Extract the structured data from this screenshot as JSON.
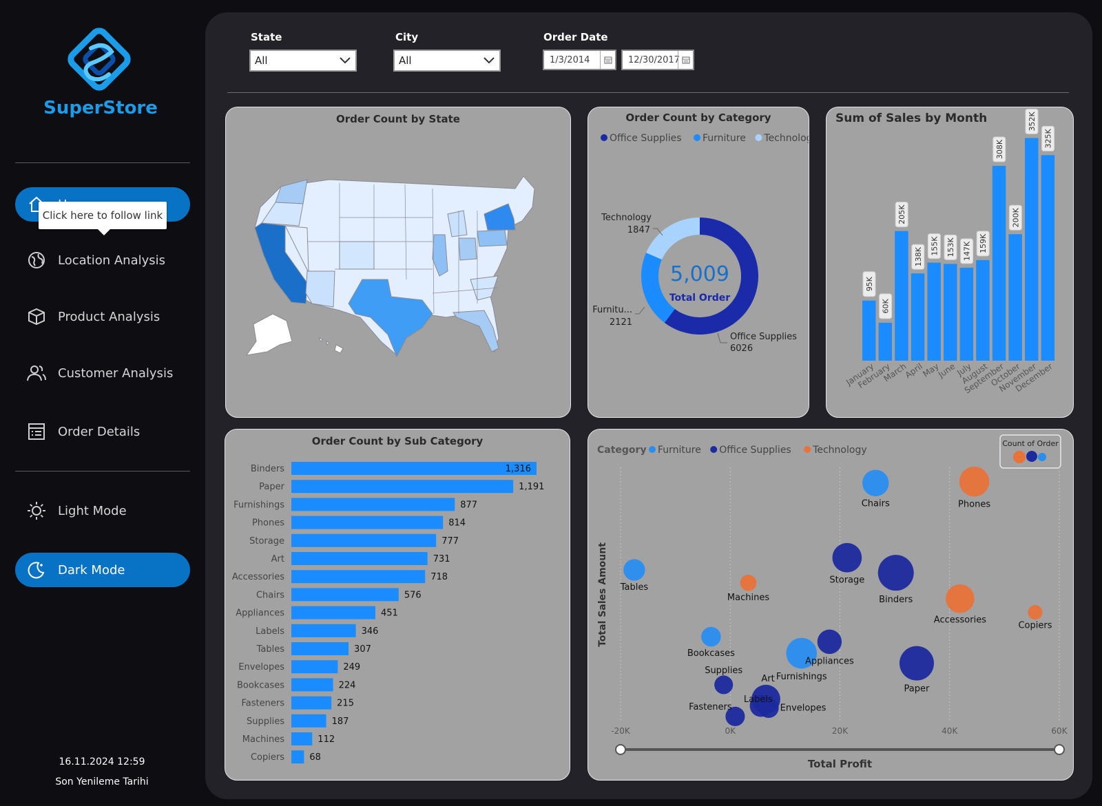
{
  "sidebar": {
    "logo_text": "SuperStore",
    "nav": [
      {
        "label": "Home",
        "icon": "home-icon",
        "active": true
      },
      {
        "label": "Location Analysis",
        "icon": "globe-icon",
        "active": false
      },
      {
        "label": "Product Analysis",
        "icon": "box-icon",
        "active": false
      },
      {
        "label": "Customer Analysis",
        "icon": "users-icon",
        "active": false
      },
      {
        "label": "Order Details",
        "icon": "list-icon",
        "active": false
      }
    ],
    "modes": [
      {
        "label": "Light Mode",
        "icon": "sun-icon",
        "active": false
      },
      {
        "label": "Dark Mode",
        "icon": "moon-icon",
        "active": true
      }
    ],
    "tooltip": "Click here to follow link",
    "refresh_time": "16.11.2024 12:59",
    "refresh_label": "Son Yenileme Tarihi"
  },
  "filters": {
    "state": {
      "label": "State",
      "value": "All"
    },
    "city": {
      "label": "City",
      "value": "All"
    },
    "order_date": {
      "label": "Order Date",
      "start": "1/3/2014",
      "end": "12/30/2017"
    }
  },
  "map_card": {
    "title": "Order Count by State"
  },
  "chart_data": [
    {
      "type": "pie",
      "title": "Order Count by Category",
      "center_value": "5,009",
      "center_label": "Total Order",
      "legend": [
        "Office Supplies",
        "Furniture",
        "Technology"
      ],
      "slices": [
        {
          "label": "Office Supplies",
          "value": 6026,
          "display": "6026",
          "color": "#1a2aa8"
        },
        {
          "label": "Furniture",
          "value": 2121,
          "display": "2121",
          "short": "Furnitu...",
          "color": "#1a8cff"
        },
        {
          "label": "Technology",
          "value": 1847,
          "display": "1847",
          "color": "#a9d3ff"
        }
      ]
    },
    {
      "type": "bar",
      "title": "Sum of Sales by Month",
      "categories": [
        "January",
        "February",
        "March",
        "April",
        "May",
        "June",
        "July",
        "August",
        "September",
        "October",
        "November",
        "December"
      ],
      "values": [
        95000,
        60000,
        205000,
        138000,
        155000,
        153000,
        147000,
        159000,
        308000,
        200000,
        352000,
        325000
      ],
      "labels": [
        "95K",
        "60K",
        "205K",
        "138K",
        "155K",
        "153K",
        "147K",
        "159K",
        "308K",
        "200K",
        "352K",
        "325K"
      ],
      "color": "#1a8cff"
    },
    {
      "type": "bar",
      "orientation": "horizontal",
      "title": "Order Count by Sub Category",
      "categories": [
        "Binders",
        "Paper",
        "Furnishings",
        "Phones",
        "Storage",
        "Art",
        "Accessories",
        "Chairs",
        "Appliances",
        "Labels",
        "Tables",
        "Envelopes",
        "Bookcases",
        "Fasteners",
        "Supplies",
        "Machines",
        "Copiers"
      ],
      "values": [
        1316,
        1191,
        877,
        814,
        777,
        731,
        718,
        576,
        451,
        346,
        307,
        249,
        224,
        215,
        187,
        112,
        68
      ],
      "labels": [
        "1,316",
        "1,191",
        "877",
        "814",
        "777",
        "731",
        "718",
        "576",
        "451",
        "346",
        "307",
        "249",
        "224",
        "215",
        "187",
        "112",
        "68"
      ],
      "color": "#1a8cff"
    },
    {
      "type": "scatter",
      "xlabel": "Total Profit",
      "ylabel": "Total Sales Amount",
      "x_ticks": [
        "-20K",
        "0K",
        "20K",
        "40K",
        "60K"
      ],
      "xlim": [
        -20000,
        60000
      ],
      "legend_title": "Category",
      "size_legend_title": "Count of Order",
      "series": [
        {
          "name": "Furniture",
          "color": "#2a8ef0"
        },
        {
          "name": "Office Supplies",
          "color": "#1d2a9e"
        },
        {
          "name": "Technology",
          "color": "#e8733a"
        }
      ],
      "points": [
        {
          "label": "Chairs",
          "series": "Furniture",
          "x": 26500,
          "y": 328000,
          "count": 576
        },
        {
          "label": "Phones",
          "series": "Technology",
          "x": 44500,
          "y": 330000,
          "count": 814
        },
        {
          "label": "Tables",
          "series": "Furniture",
          "x": -17500,
          "y": 207000,
          "count": 307
        },
        {
          "label": "Machines",
          "series": "Technology",
          "x": 3300,
          "y": 189000,
          "count": 112
        },
        {
          "label": "Storage",
          "series": "Office Supplies",
          "x": 21300,
          "y": 224000,
          "count": 777
        },
        {
          "label": "Binders",
          "series": "Office Supplies",
          "x": 30200,
          "y": 203000,
          "count": 1316
        },
        {
          "label": "Accessories",
          "series": "Technology",
          "x": 41900,
          "y": 167000,
          "count": 718
        },
        {
          "label": "Copiers",
          "series": "Technology",
          "x": 55600,
          "y": 148000,
          "count": 68
        },
        {
          "label": "Bookcases",
          "series": "Furniture",
          "x": -3500,
          "y": 114000,
          "count": 224
        },
        {
          "label": "Appliances",
          "series": "Office Supplies",
          "x": 18100,
          "y": 107000,
          "count": 451
        },
        {
          "label": "Furnishings",
          "series": "Furniture",
          "x": 13000,
          "y": 91000,
          "count": 877
        },
        {
          "label": "Paper",
          "series": "Office Supplies",
          "x": 34000,
          "y": 77000,
          "count": 1191
        },
        {
          "label": "Supplies",
          "series": "Office Supplies",
          "x": -1200,
          "y": 47000,
          "count": 187
        },
        {
          "label": "Art",
          "series": "Office Supplies",
          "x": 6500,
          "y": 27000,
          "count": 731
        },
        {
          "label": "Labels",
          "series": "Office Supplies",
          "x": 5600,
          "y": 18000,
          "count": 346
        },
        {
          "label": "Envelopes",
          "series": "Office Supplies",
          "x": 7000,
          "y": 15000,
          "count": 249
        },
        {
          "label": "Fasteners",
          "series": "Office Supplies",
          "x": 900,
          "y": 3000,
          "count": 215
        }
      ]
    }
  ]
}
